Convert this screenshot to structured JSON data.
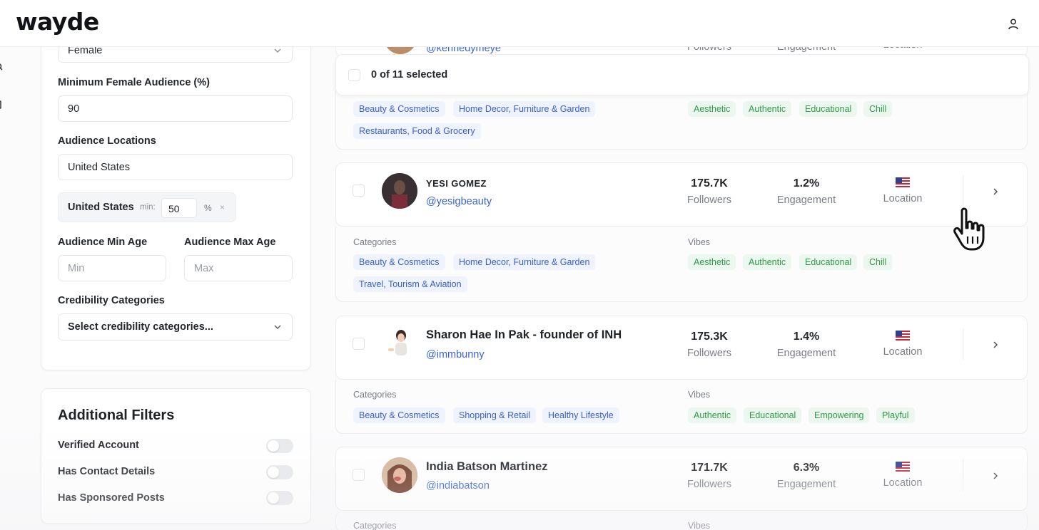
{
  "app": {
    "logo": "wayde"
  },
  "filters": {
    "gender_value": "Female",
    "min_female_label": "Minimum Female Audience (%)",
    "min_female_value": "90",
    "locations_label": "Audience Locations",
    "locations_value": "United States",
    "location_chip": {
      "name": "United States",
      "min_label": "min:",
      "min_value": "50",
      "unit": "%",
      "remove": "×"
    },
    "min_age_label": "Audience Min Age",
    "max_age_label": "Audience Max Age",
    "min_age_placeholder": "Min",
    "max_age_placeholder": "Max",
    "credibility_label": "Credibility Categories",
    "credibility_placeholder": "Select credibility categories..."
  },
  "additional_filters": {
    "title": "Additional Filters",
    "toggles": [
      {
        "label": "Verified Account",
        "on": false
      },
      {
        "label": "Has Contact Details",
        "on": false
      },
      {
        "label": "Has Sponsored Posts",
        "on": false
      }
    ]
  },
  "selection": {
    "text": "0 of 11 selected"
  },
  "top_partial": {
    "handle": "@kennedymeye",
    "followers_label": "Followers",
    "engagement_label": "Engagement",
    "location_label": "Location",
    "categories": [
      "Beauty & Cosmetics",
      "Home Decor, Furniture & Garden",
      "Restaurants, Food & Grocery"
    ],
    "vibes": [
      "Aesthetic",
      "Authentic",
      "Educational",
      "Chill"
    ]
  },
  "influencers": [
    {
      "name": "YESI GOMEZ",
      "handle": "@yesigbeauty",
      "followers": "175.7K",
      "followers_label": "Followers",
      "engagement": "1.2%",
      "engagement_label": "Engagement",
      "location_label": "Location",
      "categories_label": "Categories",
      "vibes_label": "Vibes",
      "categories": [
        "Beauty & Cosmetics",
        "Home Decor, Furniture & Garden",
        "Travel, Tourism & Aviation"
      ],
      "vibes": [
        "Aesthetic",
        "Authentic",
        "Educational",
        "Chill"
      ]
    },
    {
      "name": "Sharon Hae In Pak - founder of INH",
      "handle": "@immbunny",
      "followers": "175.3K",
      "followers_label": "Followers",
      "engagement": "1.4%",
      "engagement_label": "Engagement",
      "location_label": "Location",
      "categories_label": "Categories",
      "vibes_label": "Vibes",
      "categories": [
        "Beauty & Cosmetics",
        "Shopping & Retail",
        "Healthy Lifestyle"
      ],
      "vibes": [
        "Authentic",
        "Educational",
        "Empowering",
        "Playful"
      ]
    },
    {
      "name": "India Batson Martinez",
      "handle": "@indiabatson",
      "followers": "171.7K",
      "followers_label": "Followers",
      "engagement": "6.3%",
      "engagement_label": "Engagement",
      "location_label": "Location",
      "categories_label": "Categories",
      "vibes_label": "Vibes"
    }
  ],
  "colors": {
    "tag_blue": "#3b5fcf",
    "tag_green": "#2f9a48",
    "handle": "#3b63d8"
  }
}
